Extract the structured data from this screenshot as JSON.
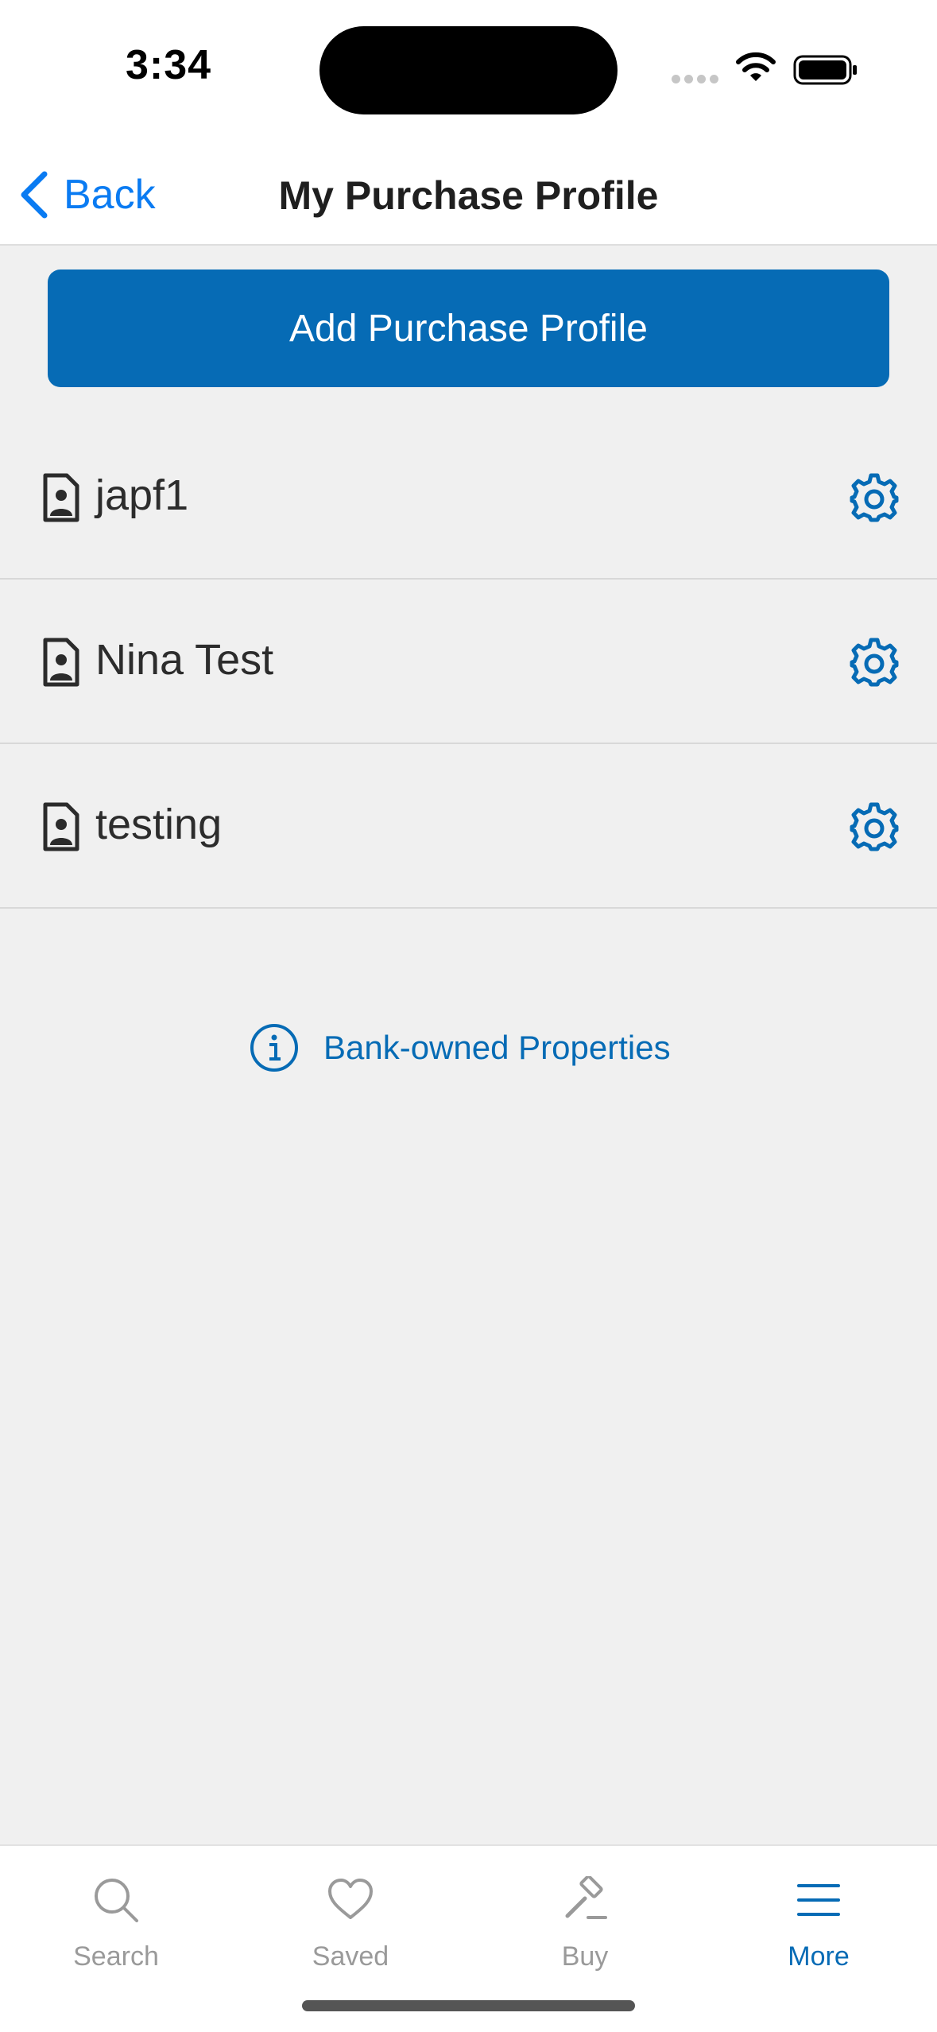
{
  "status_bar": {
    "time": "3:34",
    "icons": [
      "signal-dots-icon",
      "wifi-icon",
      "battery-icon"
    ]
  },
  "nav": {
    "back_label": "Back",
    "title": "My Purchase Profile",
    "back_icon": "chevron-left-icon"
  },
  "add_button": {
    "label": "Add Purchase Profile"
  },
  "profiles": [
    {
      "name": "japf1",
      "icon": "contact-document-icon",
      "action_icon": "gear-icon"
    },
    {
      "name": "Nina Test",
      "icon": "contact-document-icon",
      "action_icon": "gear-icon"
    },
    {
      "name": "testing",
      "icon": "contact-document-icon",
      "action_icon": "gear-icon"
    }
  ],
  "info_link": {
    "label": "Bank-owned Properties",
    "icon": "info-circle-icon"
  },
  "tab_bar": {
    "tabs": [
      {
        "label": "Search",
        "icon": "search-icon",
        "active": false
      },
      {
        "label": "Saved",
        "icon": "heart-icon",
        "active": false
      },
      {
        "label": "Buy",
        "icon": "gavel-icon",
        "active": false
      },
      {
        "label": "More",
        "icon": "menu-icon",
        "active": true
      }
    ]
  },
  "colors": {
    "primary": "#066bb5",
    "ios_link": "#0a7bf2",
    "background": "#f0f0f0",
    "inactive_tab": "#9a9a9a"
  }
}
